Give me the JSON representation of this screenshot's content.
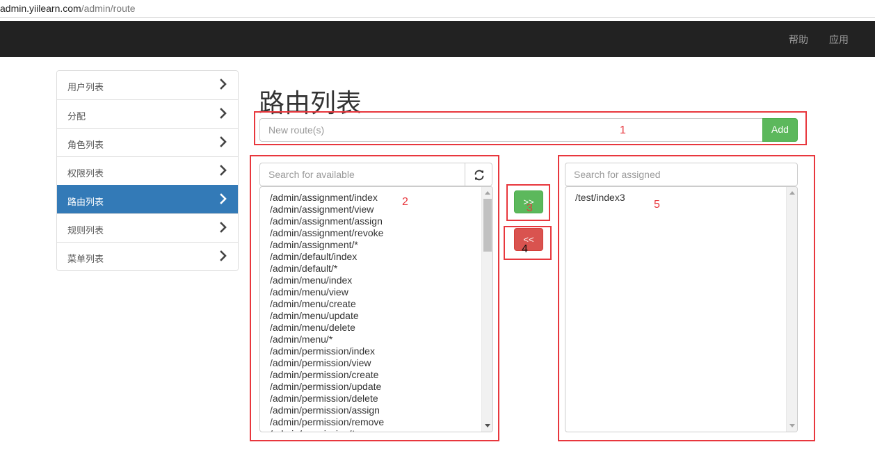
{
  "browser": {
    "url_host": "admin.yiilearn.com",
    "url_path": "/admin/route"
  },
  "navbar": {
    "links": [
      "帮助",
      "应用"
    ],
    "background": "#222222"
  },
  "sidebar": {
    "active_color": "#337ab7",
    "items": [
      {
        "label": "用户列表",
        "active": false
      },
      {
        "label": "分配",
        "active": false
      },
      {
        "label": "角色列表",
        "active": false
      },
      {
        "label": "权限列表",
        "active": false
      },
      {
        "label": "路由列表",
        "active": true
      },
      {
        "label": "规则列表",
        "active": false
      },
      {
        "label": "菜单列表",
        "active": false
      }
    ]
  },
  "main": {
    "title": "路由列表",
    "new_route": {
      "placeholder": "New route(s)",
      "value": "",
      "add_label": "Add"
    },
    "available": {
      "search_placeholder": "Search for available",
      "refresh_icon": "refresh-icon",
      "items": [
        "/admin/assignment/index",
        "/admin/assignment/view",
        "/admin/assignment/assign",
        "/admin/assignment/revoke",
        "/admin/assignment/*",
        "/admin/default/index",
        "/admin/default/*",
        "/admin/menu/index",
        "/admin/menu/view",
        "/admin/menu/create",
        "/admin/menu/update",
        "/admin/menu/delete",
        "/admin/menu/*",
        "/admin/permission/index",
        "/admin/permission/view",
        "/admin/permission/create",
        "/admin/permission/update",
        "/admin/permission/delete",
        "/admin/permission/assign",
        "/admin/permission/remove",
        "/admin/permission/*"
      ]
    },
    "assign_label": ">>",
    "remove_label": "<<",
    "assigned": {
      "search_placeholder": "Search for assigned",
      "items": [
        "/test/index3"
      ]
    }
  },
  "annotations": {
    "color": "#e8373d",
    "labels": [
      "1",
      "2",
      "3",
      "4",
      "5"
    ]
  }
}
